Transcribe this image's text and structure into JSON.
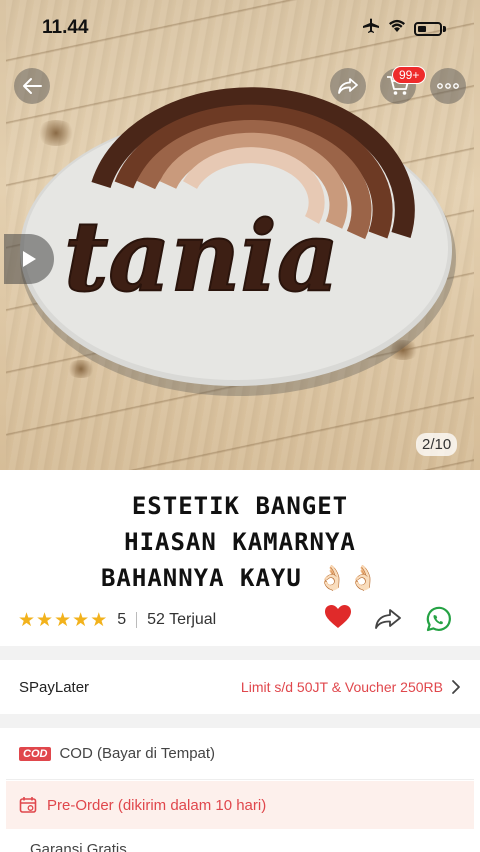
{
  "status_bar": {
    "time": "11.44"
  },
  "header": {
    "cart_badge": "99+",
    "image_counter": "2/10"
  },
  "caption": {
    "line1": "ESTETIK BANGET",
    "line2": "HIASAN KAMARNYA",
    "line3": "BAHANNYA KAYU 👌🏻👌🏻"
  },
  "product": {
    "rating": "5",
    "sold": "52 Terjual"
  },
  "paylater": {
    "label": "SPayLater",
    "value": "Limit s/d 50JT & Voucher 250RB"
  },
  "cod": {
    "badge": "COD",
    "label": "COD (Bayar di Tempat)"
  },
  "preorder": {
    "label": "Pre-Order (dikirim dalam 10 hari)"
  },
  "next_row": {
    "label": "Garansi Gratis..."
  },
  "colors": {
    "accent": "#e0474c",
    "star": "#f2b21c",
    "heart": "#e02a2a",
    "whatsapp": "#25a244"
  },
  "icons": [
    "back-icon",
    "share-icon",
    "cart-icon",
    "more-icon",
    "play-icon",
    "star-icon",
    "heart-icon",
    "whatsapp-icon",
    "chevron-right-icon",
    "calendar-icon"
  ]
}
